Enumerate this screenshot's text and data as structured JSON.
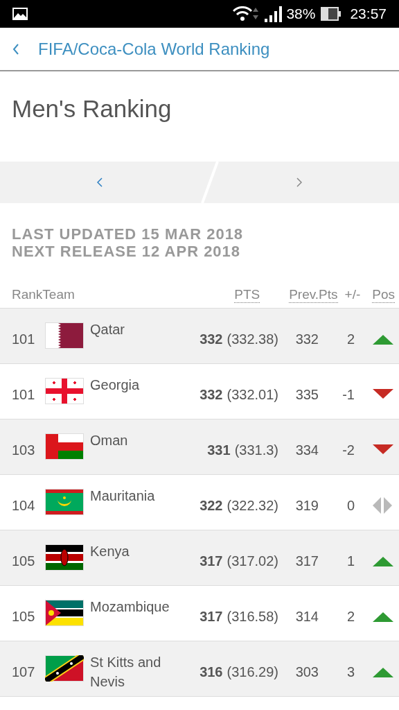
{
  "status_bar": {
    "battery": "38%",
    "time": "23:57"
  },
  "header": {
    "title": "FIFA/Coca-Cola World Ranking"
  },
  "page_title": "Men's Ranking",
  "pager": [
    {
      "kind": "prev",
      "active": true
    },
    {
      "kind": "next",
      "active": false
    }
  ],
  "updates": [
    "LAST UPDATED 15 MAR 2018",
    "NEXT RELEASE 12 APR 2018"
  ],
  "table": {
    "columns": [
      "RankTeam",
      "PTS",
      "Prev.Pts",
      "+/-",
      "Pos"
    ],
    "rows": [
      {
        "rank": "101",
        "team": "Qatar",
        "pts": "332",
        "exact": "(332.38)",
        "prev_pts": "332",
        "change": "2",
        "kind": "up"
      },
      {
        "rank": "101",
        "team": "Georgia",
        "pts": "332",
        "exact": "(332.01)",
        "prev_pts": "335",
        "change": "-1",
        "kind": "down"
      },
      {
        "rank": "103",
        "team": "Oman",
        "pts": "331",
        "exact": "(331.3)",
        "prev_pts": "334",
        "change": "-2",
        "kind": "down"
      },
      {
        "rank": "104",
        "team": "Mauritania",
        "pts": "322",
        "exact": "(322.32)",
        "prev_pts": "319",
        "change": "0",
        "kind": "same"
      },
      {
        "rank": "105",
        "team": "Kenya",
        "pts": "317",
        "exact": "(317.02)",
        "prev_pts": "317",
        "change": "1",
        "kind": "up"
      },
      {
        "rank": "105",
        "team": "Mozambique",
        "pts": "317",
        "exact": "(316.58)",
        "prev_pts": "314",
        "change": "2",
        "kind": "up"
      },
      {
        "rank": "107",
        "team": "St Kitts and Nevis",
        "pts": "316",
        "exact": "(316.29)",
        "prev_pts": "303",
        "change": "3",
        "kind": "up"
      }
    ]
  }
}
